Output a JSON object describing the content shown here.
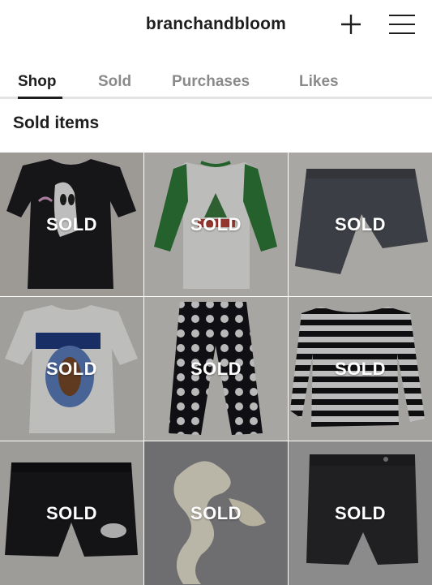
{
  "header": {
    "username": "branchandbloom",
    "icons": {
      "add": "plus-icon",
      "menu": "hamburger-menu-icon"
    }
  },
  "tabs": [
    {
      "label": "Shop",
      "active": true
    },
    {
      "label": "Sold",
      "active": false
    },
    {
      "label": "Purchases",
      "active": false
    },
    {
      "label": "Likes",
      "active": false
    }
  ],
  "section": {
    "title": "Sold items"
  },
  "items": [
    {
      "overlay": "SOLD",
      "subject": "black graphic tee"
    },
    {
      "overlay": "SOLD",
      "subject": "green raglan holiday tee"
    },
    {
      "overlay": "SOLD",
      "subject": "grey shorts"
    },
    {
      "overlay": "SOLD",
      "subject": "white graphic tee"
    },
    {
      "overlay": "SOLD",
      "subject": "polka dot pants"
    },
    {
      "overlay": "SOLD",
      "subject": "striped long sleeve"
    },
    {
      "overlay": "SOLD",
      "subject": "black shorts"
    },
    {
      "overlay": "SOLD",
      "subject": "cream crochet scarf"
    },
    {
      "overlay": "SOLD",
      "subject": "black denim shorts"
    }
  ]
}
